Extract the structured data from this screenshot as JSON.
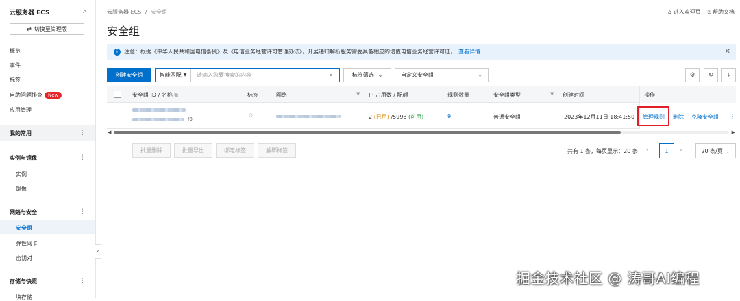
{
  "sidebar": {
    "title": "云服务器 ECS",
    "switch_label": "切换至简理版",
    "items": [
      "概览",
      "事件",
      "标签",
      "自助问题排查",
      "应用管理"
    ],
    "new_badge": "New",
    "groups": [
      {
        "label": "我的常用",
        "subs": []
      },
      {
        "label": "实例与镜像",
        "subs": [
          "实例",
          "镜像"
        ]
      },
      {
        "label": "网络与安全",
        "subs": [
          "安全组",
          "弹性网卡",
          "密钥对"
        ]
      },
      {
        "label": "存储与快照",
        "subs": [
          "块存储"
        ]
      }
    ],
    "active_item": "安全组"
  },
  "breadcrumb": {
    "root": "云服务器 ECS",
    "sep": "/",
    "current": "安全组"
  },
  "top_links": {
    "welcome": "进入欢迎页",
    "help": "帮助文档"
  },
  "page_title": "安全组",
  "notice": {
    "text": "注意：根据《中华人民共和国电信条例》及《电信业务经营许可管理办法》，开展递归解析服务需要具备相应的增值电信业务经营许可证，",
    "link": "查看详情"
  },
  "toolbar": {
    "create_label": "创建安全组",
    "search_mode": "智能匹配",
    "search_placeholder": "请输入您要搜索的内容",
    "tag_filter": "标签筛选",
    "custom_select": "自定义安全组"
  },
  "table": {
    "headers": [
      "安全组 ID / 名称",
      "标签",
      "网络",
      "IP 占用数 / 配额",
      "规则数量",
      "安全组类型",
      "创建时间",
      "操作"
    ],
    "row": {
      "ip_used": "2",
      "ip_used_tag": "(已用)",
      "ip_quota": "/5998",
      "ip_quota_tag": "(可用)",
      "rules": "9",
      "type": "普通安全组",
      "created": "2023年12月11日 18:41:50",
      "name_suffix": "f3"
    },
    "actions": {
      "manage": "管理规则",
      "delete": "删除",
      "clone": "克隆安全组"
    }
  },
  "bottom": {
    "batch": [
      "批量删除",
      "批量导出",
      "绑定标签",
      "解绑标签"
    ],
    "total": "共有 1 条，每页显示：20 条",
    "page": "1",
    "page_size": "20 条/页"
  },
  "watermark": "掘金技术社区 @ 涛哥AI编程"
}
